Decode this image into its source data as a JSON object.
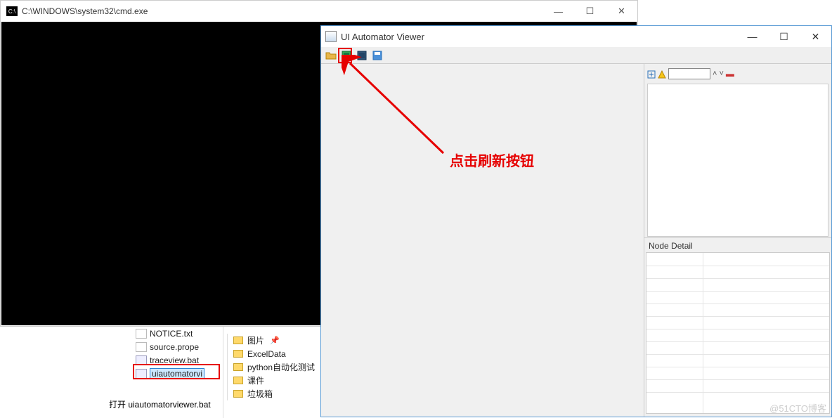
{
  "cmd": {
    "title": "C:\\WINDOWS\\system32\\cmd.exe",
    "icon_label": "C:\\"
  },
  "files_left": [
    {
      "name": "NOTICE.txt",
      "cut": true
    },
    {
      "name": "source.prope",
      "cut": true
    },
    {
      "name": "traceview.bat",
      "cut": true
    },
    {
      "name": "uiautomatorvi",
      "highlighted": true
    }
  ],
  "open_line": "打开 uiautomatorviewer.bat",
  "quick_access": {
    "header": "图片",
    "pin": "📌",
    "items": [
      "ExcelData",
      "python自动化测试",
      "课件",
      "垃圾箱"
    ]
  },
  "uia": {
    "title": "UI Automator Viewer",
    "detail_title": "Node Detail"
  },
  "annotation": {
    "text": "点击刷新按钮"
  },
  "watermark": "@51CTO博客"
}
